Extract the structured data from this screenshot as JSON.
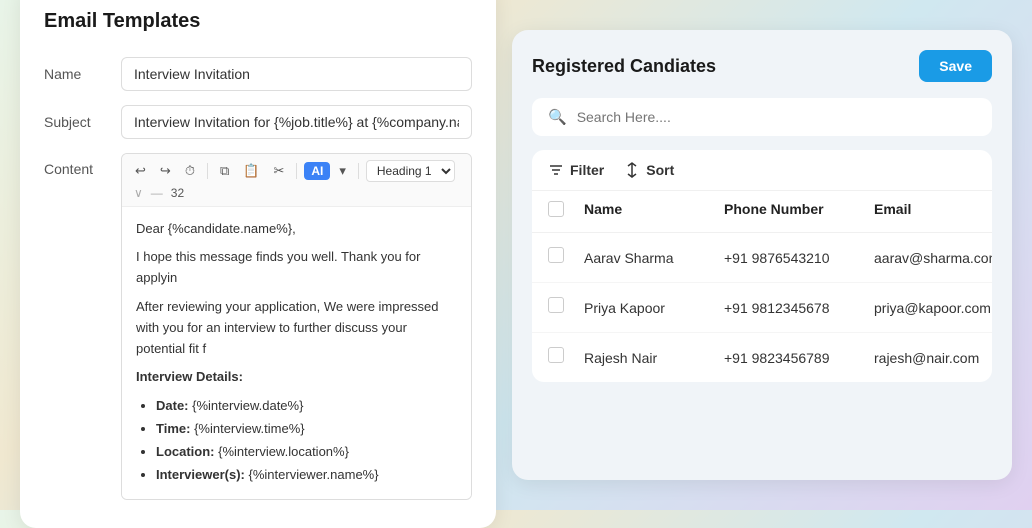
{
  "leftPanel": {
    "title": "Email Templates",
    "nameLabel": "Name",
    "nameValue": "Interview Invitation",
    "subjectLabel": "Subject",
    "subjectValue": "Interview Invitation for {%job.title%} at {%company.name%}",
    "contentLabel": "Content",
    "toolbar": {
      "undoLabel": "↩",
      "redoLabel": "↪",
      "historyLabel": "⌚",
      "copyLabel": "⧉",
      "pasteLabel": "⧉",
      "clipLabel": "✂",
      "aiLabel": "AI",
      "aiDropLabel": "▾",
      "headingValue": "Heading 1",
      "fontSizeValue": "32"
    },
    "editorContent": {
      "greeting": "Dear {%candidate.name%},",
      "line1": "I hope this message finds you well. Thank you for applyin",
      "line2": "After reviewing your application, We were impressed with you for an interview to further discuss your potential fit f",
      "detailsHeading": "Interview Details:",
      "bullet1": "Date: {%interview.date%}",
      "bullet2": "Time: {%interview.time%}",
      "bullet3": "Location: {%interview.location%}",
      "bullet4": "Interviewer(s): {%interviewer.name%}"
    }
  },
  "rightPanel": {
    "title": "Registered Candiates",
    "saveLabel": "Save",
    "searchPlaceholder": "Search Here....",
    "filterLabel": "Filter",
    "sortLabel": "Sort",
    "tableHeaders": {
      "name": "Name",
      "phone": "Phone Number",
      "email": "Email"
    },
    "candidates": [
      {
        "name": "Aarav Sharma",
        "phone": "+91 9876543210",
        "email": "aarav@sharma.com"
      },
      {
        "name": "Priya Kapoor",
        "phone": "+91 9812345678",
        "email": "priya@kapoor.com"
      },
      {
        "name": "Rajesh Nair",
        "phone": "+91 9823456789",
        "email": "rajesh@nair.com"
      }
    ]
  },
  "colors": {
    "accent": "#1a9be6"
  }
}
